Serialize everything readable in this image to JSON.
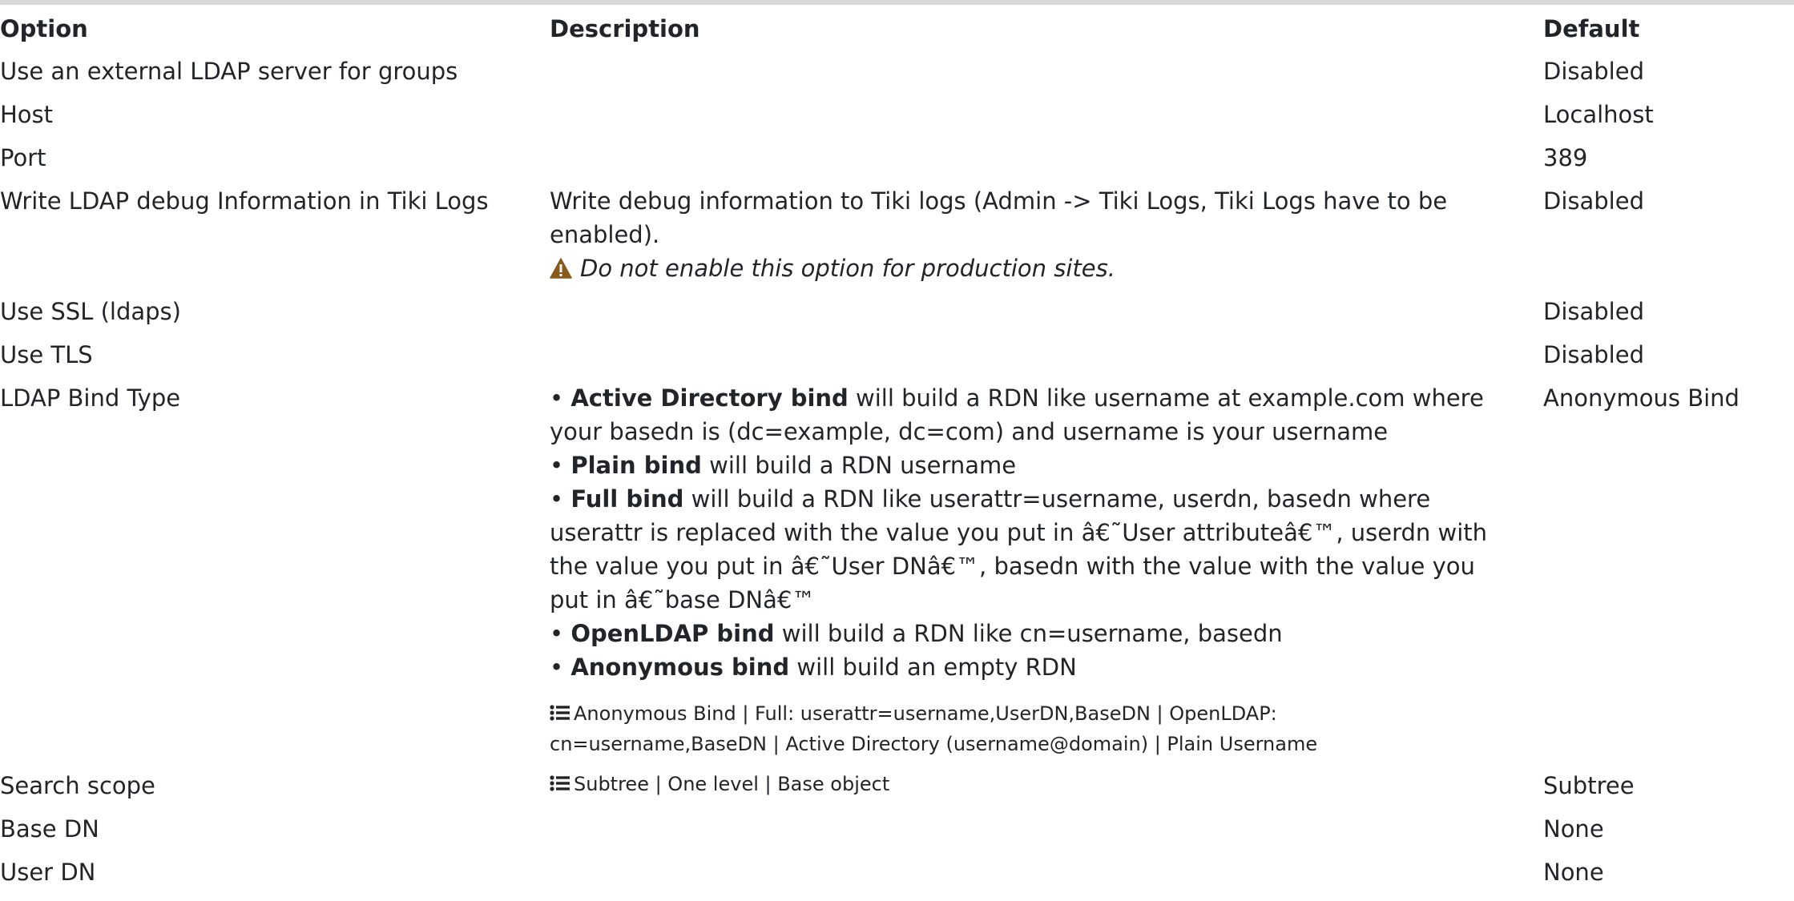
{
  "headers": {
    "option": "Option",
    "description": "Description",
    "default": "Default"
  },
  "rows": [
    {
      "option": "Use an external LDAP server for groups",
      "default": "Disabled"
    },
    {
      "option": "Host",
      "default": "Localhost"
    },
    {
      "option": "Port",
      "default": "389"
    },
    {
      "option": "Write LDAP debug Information in Tiki Logs",
      "description": "Write debug information to Tiki logs (Admin -> Tiki Logs, Tiki Logs have to be enabled).",
      "warning": "Do not enable this option for production sites.",
      "default": "Disabled"
    },
    {
      "option": "Use SSL (ldaps)",
      "default": "Disabled"
    },
    {
      "option": "Use TLS",
      "default": "Disabled"
    },
    {
      "option": "LDAP Bind Type",
      "bullets": [
        {
          "bold": "Active Directory bind",
          "text": " will build a RDN like username at example.com where your basedn is (dc=example, dc=com) and username is your username"
        },
        {
          "bold": "Plain bind",
          "text": " will build a RDN username"
        },
        {
          "bold": "Full bind",
          "text": " will build a RDN like userattr=username, userdn, basedn where userattr is replaced with the value you put in â€˜User attributeâ€™, userdn with the value you put in â€˜User DNâ€™, basedn with the value with the value you put in â€˜base DNâ€™"
        },
        {
          "bold": "OpenLDAP bind",
          "text": " will build a RDN like cn=username, basedn"
        },
        {
          "bold": "Anonymous bind",
          "text": " will build an empty RDN"
        }
      ],
      "options": "Anonymous Bind | Full: userattr=username,UserDN,BaseDN | OpenLDAP: cn=username,BaseDN | Active Directory (username@domain) | Plain Username",
      "default": "Anonymous Bind"
    },
    {
      "option": "Search scope",
      "options": "Subtree | One level | Base object",
      "default": "Subtree"
    },
    {
      "option": "Base DN",
      "default": "None"
    },
    {
      "option": "User DN",
      "default": "None"
    }
  ],
  "bullet_char": "•",
  "icons": {
    "warning": "warning-triangle-icon",
    "options_list": "list-icon"
  },
  "colors": {
    "text": "#212529",
    "warning_icon": "#8a5a1a",
    "top_border": "#d9d9d9"
  }
}
